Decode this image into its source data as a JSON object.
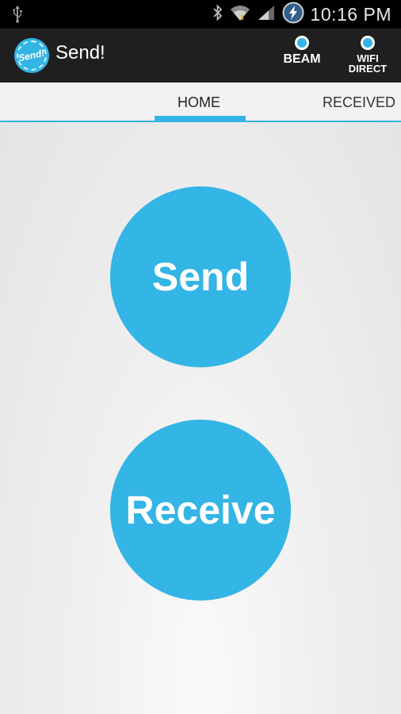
{
  "status_bar": {
    "time": "10:16 PM",
    "icons": [
      "usb-icon",
      "bluetooth-icon",
      "wifi-icon",
      "signal-icon",
      "battery-charging-icon"
    ]
  },
  "action_bar": {
    "logo_text": "Send!",
    "title": "Send!",
    "beam_label": "BEAM",
    "wifi_label_line1": "WIFI",
    "wifi_label_line2": "DIRECT"
  },
  "tabs": [
    {
      "label": "HOME",
      "selected": true
    },
    {
      "label": "RECEIVED",
      "selected": false
    }
  ],
  "main": {
    "send_label": "Send",
    "receive_label": "Receive"
  },
  "colors": {
    "accent": "#33b5e5",
    "action_bar": "#1f1f1f",
    "status_bar": "#000000"
  }
}
